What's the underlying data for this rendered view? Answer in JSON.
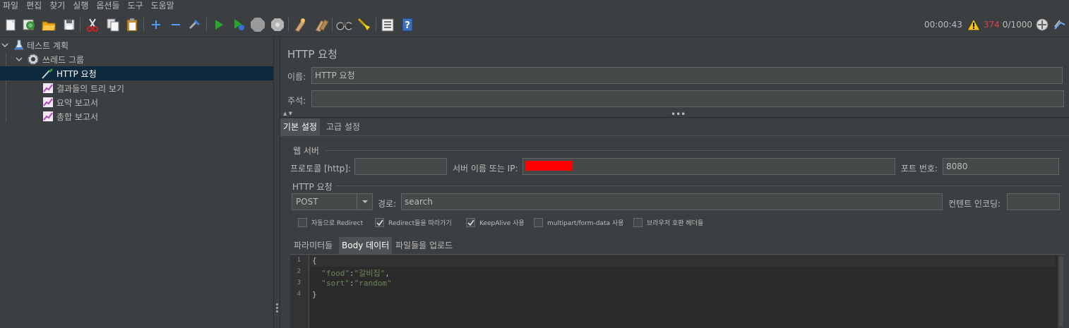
{
  "menu": [
    "파일",
    "편집",
    "찾기",
    "실행",
    "옵션들",
    "도구",
    "도움말"
  ],
  "status": {
    "elapsed": "00:00:43",
    "error_count": "374",
    "threads": "0/1000"
  },
  "tree": {
    "test_plan": "테스트 계획",
    "thread_group": "쓰레드 그룹",
    "http_request": "HTTP 요청",
    "listener_tree": "결과들의 트리 보기",
    "listener_summary": "요약 보고서",
    "listener_aggregate": "총합 보고서"
  },
  "panel": {
    "title": "HTTP 요청",
    "name_label": "이름:",
    "name_value": "HTTP 요청",
    "comment_label": "주석:",
    "comment_value": "",
    "tabs": [
      "기본 설정",
      "고급 설정"
    ]
  },
  "web_server": {
    "title": "웹 서버",
    "protocol_label": "프로토콜 [http]:",
    "protocol_value": "",
    "server_label": "서버 이름 또는 IP:",
    "port_label": "포트 번호:",
    "port_value": "8080"
  },
  "http_request": {
    "title": "HTTP 요청",
    "method": "POST",
    "path_label": "경로:",
    "path_value": "search",
    "encoding_label": "컨텐트 인코딩:",
    "encoding_value": "",
    "checks": [
      {
        "label": "자동으로 Redirect",
        "checked": false
      },
      {
        "label": "Redirect들을 따라가기",
        "checked": true
      },
      {
        "label": "KeepAlive 사용",
        "checked": true
      },
      {
        "label": "multipart/form-data 사용",
        "checked": false
      },
      {
        "label": "브라우저 호환 헤더들",
        "checked": false
      }
    ],
    "subtabs": [
      "파라미터들",
      "Body 데이터",
      "파일들을 업로드"
    ]
  },
  "body": {
    "line_numbers": [
      "1",
      "2",
      "3",
      "4"
    ],
    "l1": "{",
    "l2_key": "\"food\"",
    "l2_colon": ":",
    "l2_value": "\"갈비집\"",
    "l2_comma": ",",
    "l3_key": "\"sort\"",
    "l3_colon": ":",
    "l3_value": "\"random\"",
    "l4": "}"
  },
  "colors": {
    "background": "#3c3f41",
    "selection": "#0d293e",
    "redaction": "#ff0000",
    "error_text": "#e04040",
    "json_string": "#6a8759"
  }
}
